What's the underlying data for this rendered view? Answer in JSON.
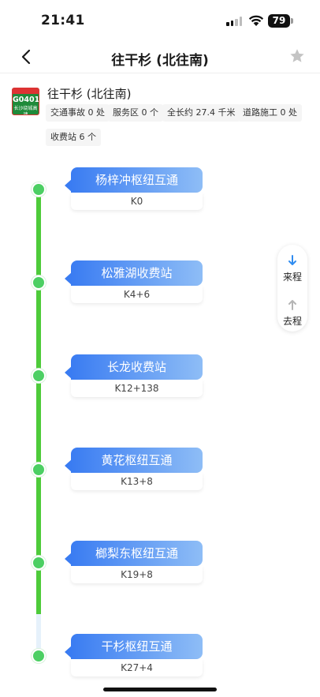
{
  "status_bar": {
    "time": "21:41",
    "battery": "79"
  },
  "nav": {
    "title": "往干杉 (北往南)"
  },
  "road": {
    "badge_code": "G0401",
    "badge_name": "长沙绕城高速",
    "name": "往干杉 (北往南)",
    "tags": [
      "交通事故 0 处",
      "服务区 0 个",
      "全长约 27.4 千米",
      "道路施工 0 处",
      "收费站 6 个"
    ]
  },
  "stations": [
    {
      "name": "杨梓冲枢纽互通",
      "km": "K0"
    },
    {
      "name": "松雅湖收费站",
      "km": "K4+6"
    },
    {
      "name": "长龙收费站",
      "km": "K12+138"
    },
    {
      "name": "黄花枢纽互通",
      "km": "K13+8"
    },
    {
      "name": "榔梨东枢纽互通",
      "km": "K19+8"
    },
    {
      "name": "干杉枢纽互通",
      "km": "K27+4"
    }
  ],
  "direction": {
    "incoming_label": "来程",
    "outgoing_label": "去程"
  },
  "colors": {
    "track": "#4ecb3a",
    "bubble_start": "#3a7cf2",
    "bubble_end": "#8ebdf6",
    "active_arrow": "#2f8cf0"
  }
}
